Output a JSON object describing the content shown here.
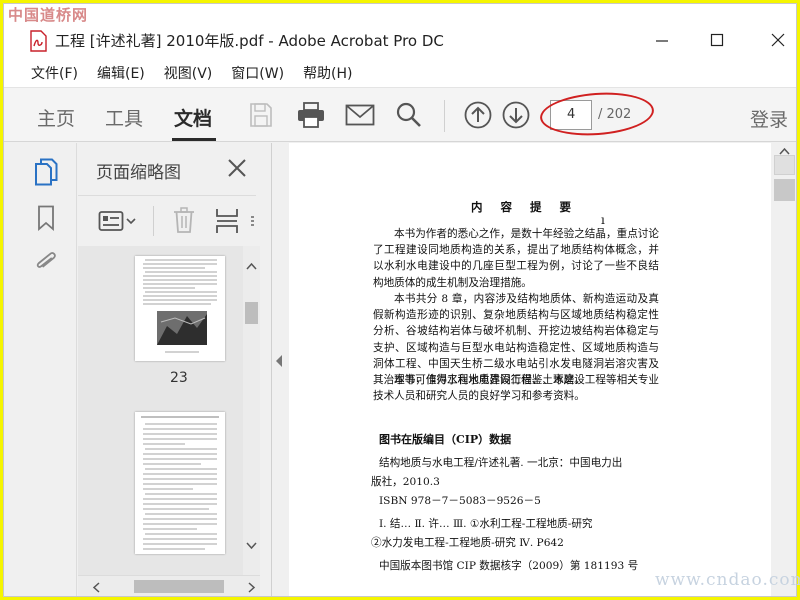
{
  "watermarks": {
    "top": "中国道桥网",
    "bottom": "www.cndao.com"
  },
  "window": {
    "title": "工程 [许述礼著] 2010年版.pdf - Adobe Acrobat Pro DC"
  },
  "menu": [
    "文件(F)",
    "编辑(E)",
    "视图(V)",
    "窗口(W)",
    "帮助(H)"
  ],
  "toolbar": {
    "tabs": [
      "主页",
      "工具",
      "文档"
    ],
    "active_tab": "文档",
    "current_page": "4",
    "total_pages": "/ 202",
    "login": "登录"
  },
  "panel": {
    "title": "页面缩略图",
    "thumb_label": "23"
  },
  "doc": {
    "title": "内 容 提 要",
    "para1": "本书为作者的悉心之作，是数十年经验之结晶，重点讨论了工程建设同地质构造的关系，提出了地质结构体概念，并以水利水电建设中的几座巨型工程为例，讨论了一些不良结构地质体的成生机制及治理措施。",
    "para2": "本书共分 8 章，内容涉及结构地质体、新构造运动及真假新构造形迹的识别、复杂地质结构与区域地质结构稳定性分析、谷坡结构岩体与破坏机制、开挖边坡结构岩体稳定与支护、区域构造与巨型水电站构造稳定性、区域地质构造与洞体工程、中国天生桥二级水电站引水发电隧洞岩溶灾害及其治理等，值得工程地质界同行借鉴、琢磨。",
    "para3": "本书可作为水利水电建设工程、土木建设工程等相关专业技术人员和研究人员的良好学习和参考资料。",
    "cip_title": "图书在版编目（CIP）数据",
    "cip_line1": "结构地质与水电工程/许述礼著. 一北京：中国电力出",
    "cip_line2": "版社，2010.3",
    "isbn": "ISBN 978－7－5083－9526－5",
    "class_line1": "Ⅰ. 结…   Ⅱ. 许…   Ⅲ. ①水利工程-工程地质-研究",
    "class_line2": "②水力发电工程-工程地质-研究   Ⅳ. P642",
    "cip_number": "中国版本图书馆 CIP 数据核字（2009）第 181193 号"
  }
}
